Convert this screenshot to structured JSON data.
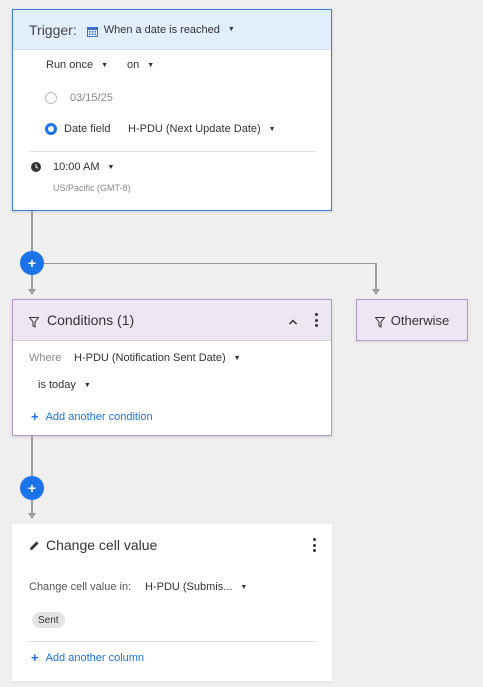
{
  "trigger": {
    "title": "Trigger:",
    "type_label": "When a date is reached",
    "type_icon": "calendar-icon",
    "frequency": "Run once",
    "on_label": "on",
    "date_option": "03/15/25",
    "date_field_label": "Date field",
    "date_field_value": "H-PDU (Next Update Date)",
    "time": "10:00 AM",
    "timezone": "US/Pacific (GMT-8)"
  },
  "conditions": {
    "title": "Conditions (1)",
    "where_label": "Where",
    "field": "H-PDU (Notification Sent Date)",
    "operator": "is today",
    "add_condition": "Add another condition"
  },
  "otherwise": {
    "title": "Otherwise"
  },
  "action": {
    "title": "Change cell value",
    "field_label": "Change cell value in:",
    "field_value": "H-PDU (Submis...",
    "value_chip": "Sent",
    "add_column": "Add another column"
  },
  "colors": {
    "accent_blue": "#1a73e8",
    "trigger_header": "#e1effd",
    "condition_header": "#ede6f3"
  }
}
